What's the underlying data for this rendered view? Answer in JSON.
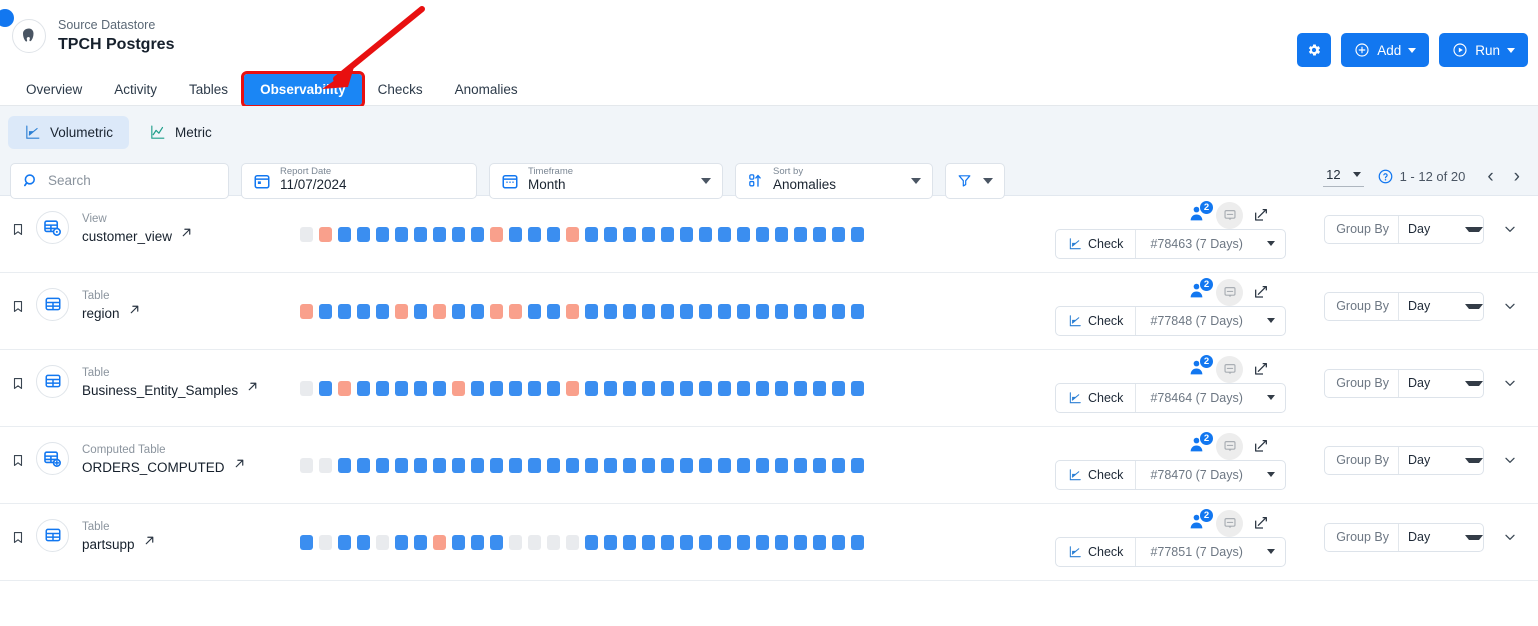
{
  "header": {
    "kicker": "Source Datastore",
    "title": "TPCH Postgres",
    "avatar_icon": "postgres-elephant-icon",
    "actions": {
      "settings_icon": "gear-icon",
      "add_label": "Add",
      "add_icon": "plus-circle-icon",
      "run_label": "Run",
      "run_icon": "play-circle-icon"
    }
  },
  "tabs": [
    {
      "label": "Overview",
      "active": false
    },
    {
      "label": "Activity",
      "active": false
    },
    {
      "label": "Tables",
      "active": false
    },
    {
      "label": "Observability",
      "active": true
    },
    {
      "label": "Checks",
      "active": false
    },
    {
      "label": "Anomalies",
      "active": false
    }
  ],
  "segments": [
    {
      "label": "Volumetric",
      "icon": "volumetric-chart-icon",
      "active": true
    },
    {
      "label": "Metric",
      "icon": "metric-line-chart-icon",
      "active": false
    }
  ],
  "filters": {
    "search": {
      "placeholder": "Search",
      "value": "",
      "icon": "search-icon"
    },
    "report_date": {
      "label": "Report Date",
      "value": "11/07/2024",
      "icon": "calendar-icon"
    },
    "timeframe": {
      "label": "Timeframe",
      "value": "Month",
      "icon": "calendar-icon"
    },
    "sort_by": {
      "label": "Sort by",
      "value": "Anomalies",
      "icon": "sort-icon"
    },
    "filter_button": {
      "icon": "funnel-icon"
    }
  },
  "pagination": {
    "page_size": "12",
    "help_icon": "help-circle-icon",
    "range": "1 - 12 of 20",
    "prev_icon": "chevron-left-icon",
    "next_icon": "chevron-right-icon"
  },
  "colors": {
    "ok": "#3b8ef0",
    "anomaly": "#f9a08c",
    "empty": "#e9ebee",
    "accent": "#1277f0",
    "tab_active": "#1a86f5",
    "highlight": "#e81010"
  },
  "rows": [
    {
      "bookmark_icon": "bookmark-icon",
      "type_icon": "view-table-icon",
      "kicker": "View",
      "name": "customer_view",
      "external_icon": "external-link-icon",
      "badge_count": "2",
      "check_label": "Check",
      "check_value": "#78463 (7 Days)",
      "group_by_label": "Group By",
      "group_by_value": "Day",
      "squares": [
        "empty",
        "anomaly",
        "ok",
        "ok",
        "ok",
        "ok",
        "ok",
        "ok",
        "ok",
        "ok",
        "anomaly",
        "ok",
        "ok",
        "ok",
        "anomaly",
        "ok",
        "ok",
        "ok",
        "ok",
        "ok",
        "ok",
        "ok",
        "ok",
        "ok",
        "ok",
        "ok",
        "ok",
        "ok",
        "ok",
        "ok"
      ]
    },
    {
      "bookmark_icon": "bookmark-icon",
      "type_icon": "table-icon",
      "kicker": "Table",
      "name": "region",
      "external_icon": "external-link-icon",
      "badge_count": "2",
      "check_label": "Check",
      "check_value": "#77848 (7 Days)",
      "group_by_label": "Group By",
      "group_by_value": "Day",
      "squares": [
        "anomaly",
        "ok",
        "ok",
        "ok",
        "ok",
        "anomaly",
        "ok",
        "anomaly",
        "ok",
        "ok",
        "anomaly",
        "anomaly",
        "ok",
        "ok",
        "anomaly",
        "ok",
        "ok",
        "ok",
        "ok",
        "ok",
        "ok",
        "ok",
        "ok",
        "ok",
        "ok",
        "ok",
        "ok",
        "ok",
        "ok",
        "ok"
      ]
    },
    {
      "bookmark_icon": "bookmark-icon",
      "type_icon": "table-icon",
      "kicker": "Table",
      "name": "Business_Entity_Samples",
      "external_icon": "external-link-icon",
      "badge_count": "2",
      "check_label": "Check",
      "check_value": "#78464 (7 Days)",
      "group_by_label": "Group By",
      "group_by_value": "Day",
      "squares": [
        "empty",
        "ok",
        "anomaly",
        "ok",
        "ok",
        "ok",
        "ok",
        "ok",
        "anomaly",
        "ok",
        "ok",
        "ok",
        "ok",
        "ok",
        "anomaly",
        "ok",
        "ok",
        "ok",
        "ok",
        "ok",
        "ok",
        "ok",
        "ok",
        "ok",
        "ok",
        "ok",
        "ok",
        "ok",
        "ok",
        "ok"
      ]
    },
    {
      "bookmark_icon": "bookmark-icon",
      "type_icon": "computed-table-icon",
      "kicker": "Computed Table",
      "name": "ORDERS_COMPUTED",
      "external_icon": "external-link-icon",
      "badge_count": "2",
      "check_label": "Check",
      "check_value": "#78470 (7 Days)",
      "group_by_label": "Group By",
      "group_by_value": "Day",
      "squares": [
        "empty",
        "empty",
        "ok",
        "ok",
        "ok",
        "ok",
        "ok",
        "ok",
        "ok",
        "ok",
        "ok",
        "ok",
        "ok",
        "ok",
        "ok",
        "ok",
        "ok",
        "ok",
        "ok",
        "ok",
        "ok",
        "ok",
        "ok",
        "ok",
        "ok",
        "ok",
        "ok",
        "ok",
        "ok",
        "ok"
      ]
    },
    {
      "bookmark_icon": "bookmark-icon",
      "type_icon": "table-icon",
      "kicker": "Table",
      "name": "partsupp",
      "external_icon": "external-link-icon",
      "badge_count": "2",
      "check_label": "Check",
      "check_value": "#77851 (7 Days)",
      "group_by_label": "Group By",
      "group_by_value": "Day",
      "squares": [
        "ok",
        "empty",
        "ok",
        "ok",
        "empty",
        "ok",
        "ok",
        "anomaly",
        "ok",
        "ok",
        "ok",
        "empty",
        "empty",
        "empty",
        "empty",
        "ok",
        "ok",
        "ok",
        "ok",
        "ok",
        "ok",
        "ok",
        "ok",
        "ok",
        "ok",
        "ok",
        "ok",
        "ok",
        "ok",
        "ok"
      ]
    }
  ]
}
